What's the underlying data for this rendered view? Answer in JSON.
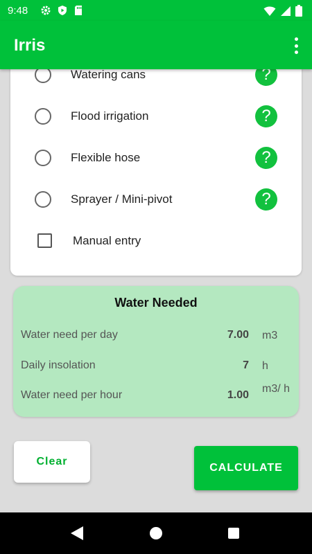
{
  "status_bar": {
    "time": "9:48",
    "icons_left": [
      "gear-icon",
      "play-protect-icon",
      "sd-card-icon"
    ],
    "icons_right": [
      "wifi-icon",
      "signal-icon",
      "battery-icon"
    ]
  },
  "app_bar": {
    "title": "Irris",
    "menu_icon": "overflow-menu-icon"
  },
  "options": [
    {
      "label": "Watering cans",
      "type": "radio",
      "selected": false,
      "help": "?"
    },
    {
      "label": "Flood irrigation",
      "type": "radio",
      "selected": false,
      "help": "?"
    },
    {
      "label": "Flexible hose",
      "type": "radio",
      "selected": false,
      "help": "?"
    },
    {
      "label": "Sprayer / Mini-pivot",
      "type": "radio",
      "selected": false,
      "help": "?"
    },
    {
      "label": "Manual entry",
      "type": "checkbox",
      "checked": false
    }
  ],
  "water_needed": {
    "title": "Water Needed",
    "rows": [
      {
        "label": "Water need per day",
        "value": "7.00",
        "unit": "m3"
      },
      {
        "label": "Daily insolation",
        "value": "7",
        "unit": "h"
      },
      {
        "label": "Water need per hour",
        "value": "1.00",
        "unit": "m3/ h"
      }
    ]
  },
  "buttons": {
    "clear": "Clear",
    "calculate": "CALCULATE"
  },
  "colors": {
    "primary": "#00c13a",
    "help_button": "#12c13e",
    "water_card_bg": "#b4e8c0",
    "background": "#dcdcdc"
  }
}
